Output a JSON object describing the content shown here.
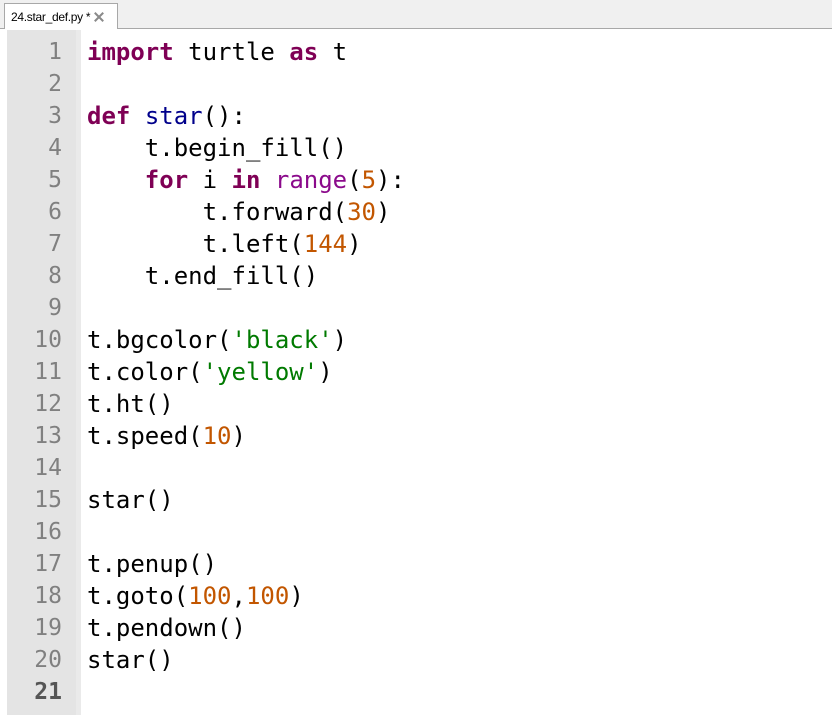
{
  "tab": {
    "title": "24.star_def.py",
    "modified_marker": "*"
  },
  "editor": {
    "current_line": 21,
    "lines": [
      {
        "n": "1",
        "tokens": [
          {
            "t": "import",
            "c": "kw"
          },
          {
            "t": " turtle ",
            "c": ""
          },
          {
            "t": "as",
            "c": "kw"
          },
          {
            "t": " t",
            "c": ""
          }
        ]
      },
      {
        "n": "2",
        "tokens": []
      },
      {
        "n": "3",
        "tokens": [
          {
            "t": "def",
            "c": "kw"
          },
          {
            "t": " ",
            "c": ""
          },
          {
            "t": "star",
            "c": "fn"
          },
          {
            "t": "():",
            "c": ""
          }
        ]
      },
      {
        "n": "4",
        "tokens": [
          {
            "t": "    t.begin_fill()",
            "c": ""
          }
        ]
      },
      {
        "n": "5",
        "tokens": [
          {
            "t": "    ",
            "c": ""
          },
          {
            "t": "for",
            "c": "kw"
          },
          {
            "t": " i ",
            "c": ""
          },
          {
            "t": "in",
            "c": "kw"
          },
          {
            "t": " ",
            "c": ""
          },
          {
            "t": "range",
            "c": "bi"
          },
          {
            "t": "(",
            "c": ""
          },
          {
            "t": "5",
            "c": "num"
          },
          {
            "t": "):",
            "c": ""
          }
        ]
      },
      {
        "n": "6",
        "tokens": [
          {
            "t": "        t.forward(",
            "c": ""
          },
          {
            "t": "30",
            "c": "num"
          },
          {
            "t": ")",
            "c": ""
          }
        ]
      },
      {
        "n": "7",
        "tokens": [
          {
            "t": "        t.left(",
            "c": ""
          },
          {
            "t": "144",
            "c": "num"
          },
          {
            "t": ")",
            "c": ""
          }
        ]
      },
      {
        "n": "8",
        "tokens": [
          {
            "t": "    t.end_fill()",
            "c": ""
          }
        ]
      },
      {
        "n": "9",
        "tokens": []
      },
      {
        "n": "10",
        "tokens": [
          {
            "t": "t.bgcolor(",
            "c": ""
          },
          {
            "t": "'black'",
            "c": "str"
          },
          {
            "t": ")",
            "c": ""
          }
        ]
      },
      {
        "n": "11",
        "tokens": [
          {
            "t": "t.color(",
            "c": ""
          },
          {
            "t": "'yellow'",
            "c": "str"
          },
          {
            "t": ")",
            "c": ""
          }
        ]
      },
      {
        "n": "12",
        "tokens": [
          {
            "t": "t.ht()",
            "c": ""
          }
        ]
      },
      {
        "n": "13",
        "tokens": [
          {
            "t": "t.speed(",
            "c": ""
          },
          {
            "t": "10",
            "c": "num"
          },
          {
            "t": ")",
            "c": ""
          }
        ]
      },
      {
        "n": "14",
        "tokens": []
      },
      {
        "n": "15",
        "tokens": [
          {
            "t": "star()",
            "c": ""
          }
        ]
      },
      {
        "n": "16",
        "tokens": []
      },
      {
        "n": "17",
        "tokens": [
          {
            "t": "t.penup()",
            "c": ""
          }
        ]
      },
      {
        "n": "18",
        "tokens": [
          {
            "t": "t.goto(",
            "c": ""
          },
          {
            "t": "100",
            "c": "num"
          },
          {
            "t": ",",
            "c": ""
          },
          {
            "t": "100",
            "c": "num"
          },
          {
            "t": ")",
            "c": ""
          }
        ]
      },
      {
        "n": "19",
        "tokens": [
          {
            "t": "t.pendown()",
            "c": ""
          }
        ]
      },
      {
        "n": "20",
        "tokens": [
          {
            "t": "star()",
            "c": ""
          }
        ]
      },
      {
        "n": "21",
        "tokens": []
      }
    ]
  }
}
